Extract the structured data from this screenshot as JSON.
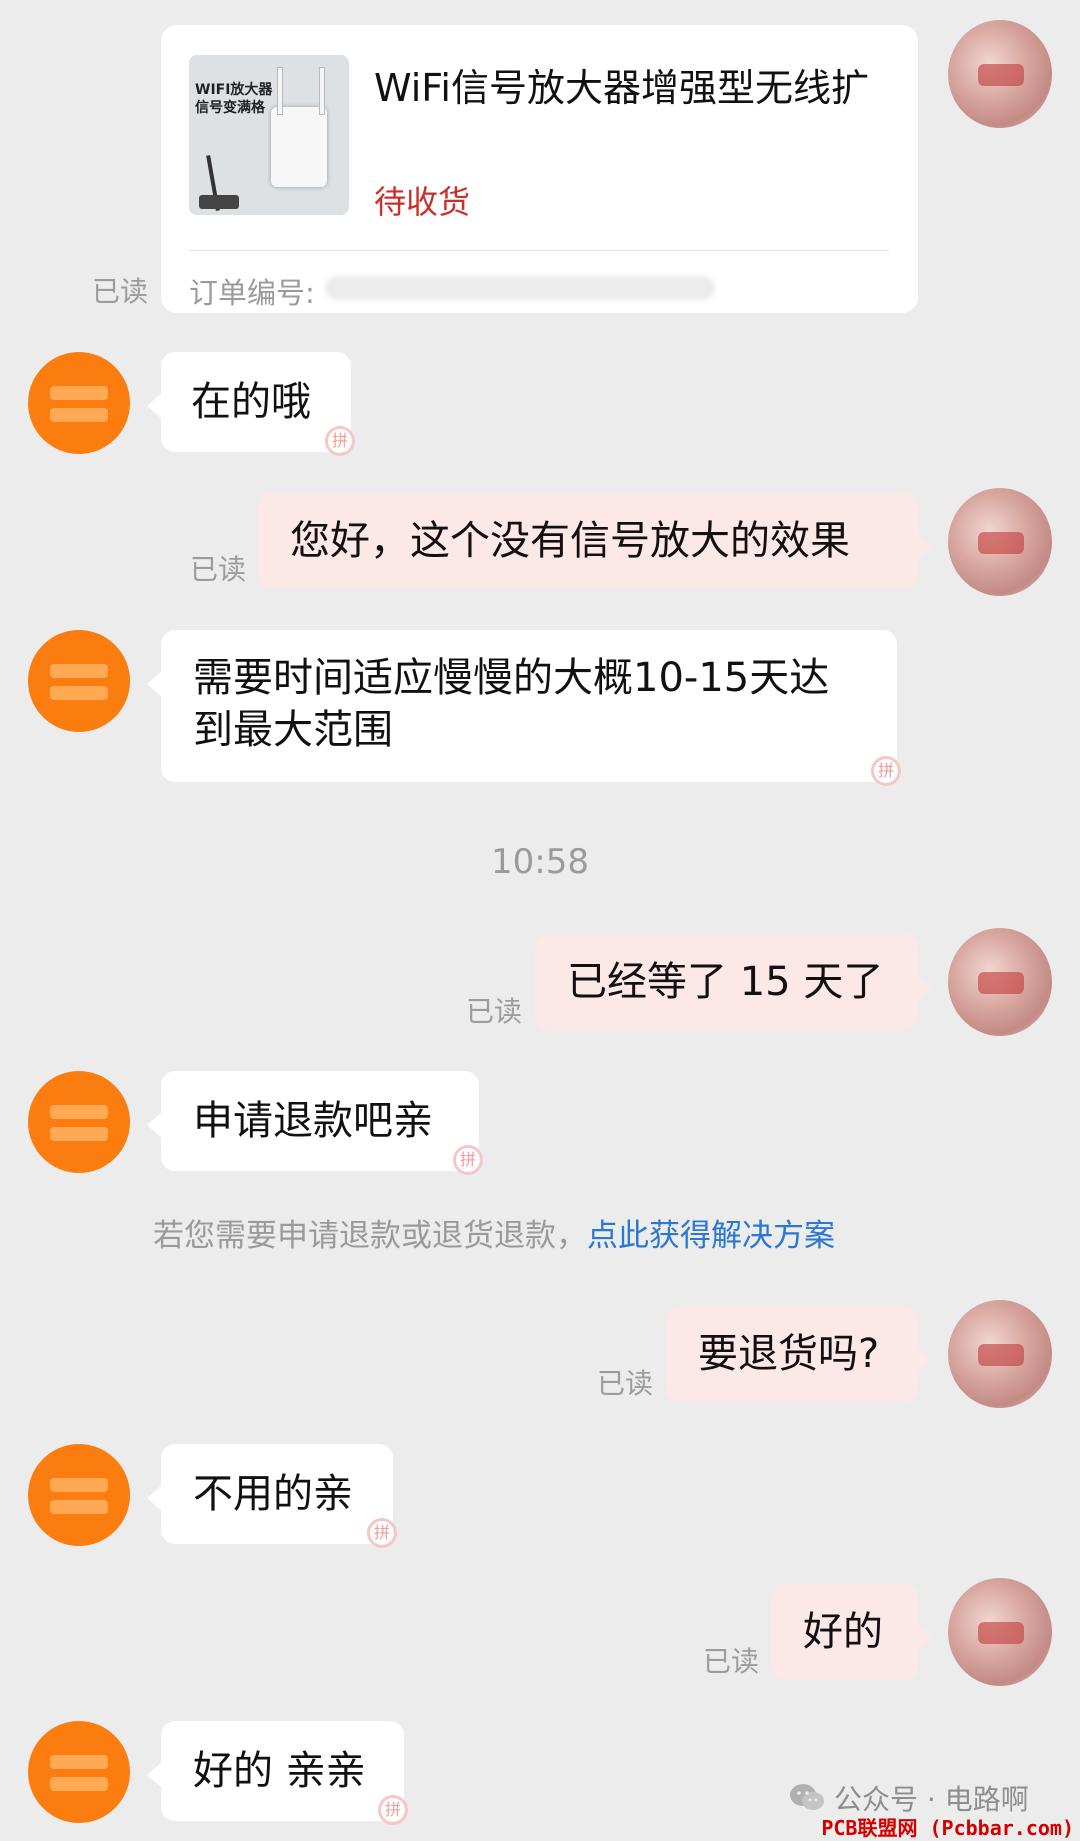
{
  "order_card": {
    "title": "WiFi信号放大器增强型无线扩",
    "status": "待收货",
    "order_label": "订单编号:",
    "image_text_1": "WIFI放大器",
    "image_text_2": "信号变满格"
  },
  "read_label": "已读",
  "messages": [
    {
      "from": "shop",
      "text": "在的哦"
    },
    {
      "from": "user",
      "text": "您好，这个没有信号放大的效果"
    },
    {
      "from": "shop",
      "text": "需要时间适应慢慢的大概10-15天达到最大范围",
      "line1": "需要时间适应慢慢的大概10-15天达",
      "line2": "到最大范围"
    },
    {
      "from": "user",
      "text": "已经等了 15 天了"
    },
    {
      "from": "shop",
      "text": "申请退款吧亲"
    },
    {
      "from": "user",
      "text": "要退货吗?"
    },
    {
      "from": "shop",
      "text": "不用的亲"
    },
    {
      "from": "user",
      "text": "好的"
    },
    {
      "from": "shop",
      "text": "好的 亲亲"
    }
  ],
  "timestamp": "10:58",
  "system_note": {
    "text": "若您需要申请退款或退货退款，",
    "link": "点此获得解决方案"
  },
  "watermark": {
    "account": "公众号 · 电路啊",
    "site": "PCB联盟网 (Pcbbar.com)"
  },
  "colors": {
    "background": "#ececec",
    "shop_avatar": "#fb7d10",
    "user_bubble": "#fde8e8",
    "status_red": "#c9302c",
    "link_blue": "#2a78d1",
    "site_red": "#d40000"
  },
  "icons": {
    "pin": "pin-badge-icon",
    "wechat": "wechat-icon"
  }
}
